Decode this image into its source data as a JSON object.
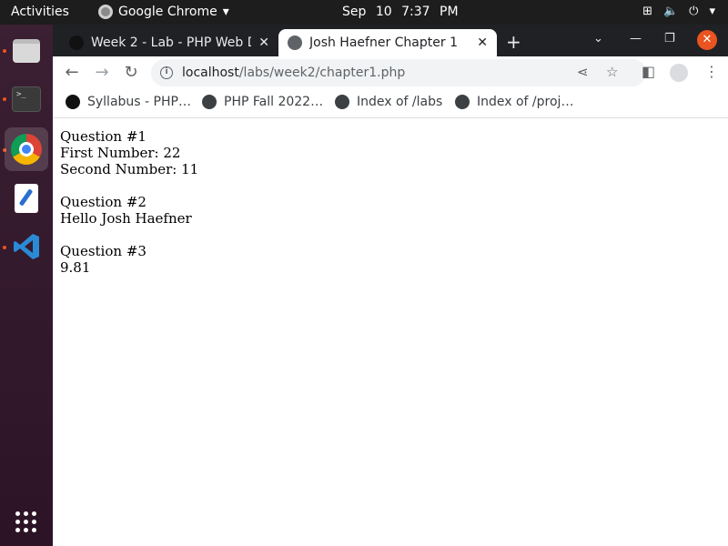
{
  "topbar": {
    "activities": "Activities",
    "app_name": "Google Chrome",
    "date": "Sep 10",
    "time": "7:37 PM"
  },
  "dock": {
    "apps": [
      "files",
      "terminal",
      "google-chrome",
      "text-editor",
      "visual-studio-code"
    ]
  },
  "browser": {
    "tabs": [
      {
        "title": "Week 2 - Lab - PHP Web De",
        "active": false
      },
      {
        "title": "Josh Haefner Chapter 1",
        "active": true
      }
    ],
    "url": {
      "host": "localhost",
      "path": "/labs/week2/chapter1.php"
    },
    "bookmarks": [
      {
        "label": "Syllabus - PHP…"
      },
      {
        "label": "PHP Fall 2022…"
      },
      {
        "label": "Index of /labs"
      },
      {
        "label": "Index of /proj…"
      }
    ]
  },
  "page": {
    "q1": {
      "heading": "Question #1",
      "first": "First Number: 22",
      "second": "Second Number: 11"
    },
    "q2": {
      "heading": "Question #2",
      "line": "Hello Josh Haefner"
    },
    "q3": {
      "heading": "Question #3",
      "value": "9.81"
    }
  },
  "colors": {
    "topbar_bg": "#1d1d1d",
    "dock_bg": "#3b1f33",
    "tabstrip_bg": "#202124",
    "accent_orange": "#e95420"
  }
}
